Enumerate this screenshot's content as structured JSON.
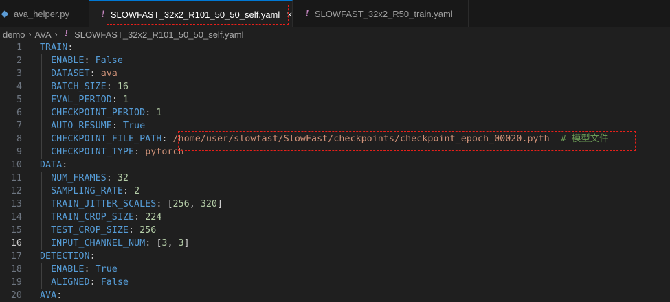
{
  "tabs": [
    {
      "label": "ava_helper.py",
      "icon": "python-file-icon"
    },
    {
      "label": "SLOWFAST_32x2_R101_50_50_self.yaml",
      "icon": "yaml-file-icon",
      "close": "×"
    },
    {
      "label": "SLOWFAST_32x2_R50_train.yaml",
      "icon": "yaml-file-icon"
    }
  ],
  "tab_icons": {
    "python": "◆",
    "yaml": "!"
  },
  "breadcrumb": {
    "items": [
      "demo",
      "AVA",
      "SLOWFAST_32x2_R101_50_50_self.yaml"
    ],
    "separator": "›"
  },
  "editor": {
    "current_line": 16,
    "lines": [
      {
        "num": "1",
        "key": "TRAIN",
        "indent": "",
        "value": "",
        "vtype": ""
      },
      {
        "num": "2",
        "key": "ENABLE",
        "indent": "  ",
        "value": "False",
        "vtype": "b"
      },
      {
        "num": "3",
        "key": "DATASET",
        "indent": "  ",
        "value": "ava",
        "vtype": "s"
      },
      {
        "num": "4",
        "key": "BATCH_SIZE",
        "indent": "  ",
        "value": "16",
        "vtype": "n"
      },
      {
        "num": "5",
        "key": "EVAL_PERIOD",
        "indent": "  ",
        "value": "1",
        "vtype": "n"
      },
      {
        "num": "6",
        "key": "CHECKPOINT_PERIOD",
        "indent": "  ",
        "value": "1",
        "vtype": "n"
      },
      {
        "num": "7",
        "key": "AUTO_RESUME",
        "indent": "  ",
        "value": "True",
        "vtype": "b"
      },
      {
        "num": "8",
        "key": "CHECKPOINT_FILE_PATH",
        "indent": "  ",
        "value": "/home/user/slowfast/SlowFast/checkpoints/checkpoint_epoch_00020.pyth",
        "vtype": "s",
        "comment": "# 模型文件"
      },
      {
        "num": "9",
        "key": "CHECKPOINT_TYPE",
        "indent": "  ",
        "value": "pytorch",
        "vtype": "s"
      },
      {
        "num": "10",
        "key": "DATA",
        "indent": "",
        "value": "",
        "vtype": ""
      },
      {
        "num": "11",
        "key": "NUM_FRAMES",
        "indent": "  ",
        "value": "32",
        "vtype": "n"
      },
      {
        "num": "12",
        "key": "SAMPLING_RATE",
        "indent": "  ",
        "value": "2",
        "vtype": "n"
      },
      {
        "num": "13",
        "key": "TRAIN_JITTER_SCALES",
        "indent": "  ",
        "value": "",
        "vtype": "list",
        "list": [
          "256",
          "320"
        ]
      },
      {
        "num": "14",
        "key": "TRAIN_CROP_SIZE",
        "indent": "  ",
        "value": "224",
        "vtype": "n"
      },
      {
        "num": "15",
        "key": "TEST_CROP_SIZE",
        "indent": "  ",
        "value": "256",
        "vtype": "n"
      },
      {
        "num": "16",
        "key": "INPUT_CHANNEL_NUM",
        "indent": "  ",
        "value": "",
        "vtype": "list",
        "list": [
          "3",
          "3"
        ]
      },
      {
        "num": "17",
        "key": "DETECTION",
        "indent": "",
        "value": "",
        "vtype": ""
      },
      {
        "num": "18",
        "key": "ENABLE",
        "indent": "  ",
        "value": "True",
        "vtype": "b"
      },
      {
        "num": "19",
        "key": "ALIGNED",
        "indent": "  ",
        "value": "False",
        "vtype": "b"
      },
      {
        "num": "20",
        "key": "AVA",
        "indent": "",
        "value": "",
        "vtype": ""
      }
    ]
  },
  "colors": {
    "key": "#569cd6",
    "string": "#ce9178",
    "number": "#b5cea8",
    "comment": "#6a9955",
    "annotation": "#e8201a"
  }
}
